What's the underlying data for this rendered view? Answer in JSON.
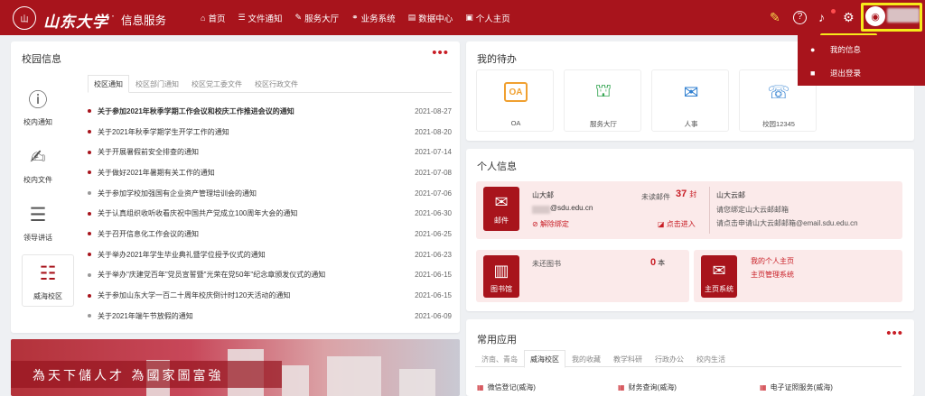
{
  "header": {
    "logo_glyph": "山",
    "brand": "山东大学",
    "separator": "·",
    "subtitle": "信息服务",
    "nav": [
      {
        "icon": "home-icon",
        "glyph": "⌂",
        "label": "首页"
      },
      {
        "icon": "list-icon",
        "glyph": "☰",
        "label": "文件通知"
      },
      {
        "icon": "edit-icon",
        "glyph": "✎",
        "label": "服务大厅"
      },
      {
        "icon": "link-icon",
        "glyph": "⚭",
        "label": "业务系统"
      },
      {
        "icon": "data-icon",
        "glyph": "▤",
        "label": "数据中心"
      },
      {
        "icon": "user-icon",
        "glyph": "▣",
        "label": "个人主页"
      }
    ],
    "icons": {
      "note": "✎",
      "help": "?",
      "bell": "♪",
      "gear": "⚙",
      "avatar": "◉"
    }
  },
  "user_menu": {
    "items": [
      {
        "icon": "person-icon",
        "glyph": "●",
        "label": "我的信息"
      },
      {
        "icon": "lock-icon",
        "glyph": "■",
        "label": "退出登录"
      }
    ]
  },
  "campus": {
    "title": "校园信息",
    "more": "•••",
    "categories": [
      {
        "label": "校内通知",
        "glyph": "ⓘ"
      },
      {
        "label": "校内文件",
        "glyph": "✍"
      },
      {
        "label": "领导讲话",
        "glyph": "☰"
      },
      {
        "label": "威海校区",
        "glyph": "☷"
      }
    ],
    "tabs": [
      "校区通知",
      "校区部门通知",
      "校区党工委文件",
      "校区行政文件"
    ],
    "news": [
      {
        "title": "关于参加2021年秋季学期工作会议和校庆工作推进会议的通知",
        "date": "2021-08-27"
      },
      {
        "title": "关于2021年秋季学期学生开学工作的通知",
        "date": "2021-08-20"
      },
      {
        "title": "关于开展暑假前安全排查的通知",
        "date": "2021-07-14"
      },
      {
        "title": "关于做好2021年暑期有关工作的通知",
        "date": "2021-07-08"
      },
      {
        "title": "关于参加学校加强国有企业资产管理培训会的通知",
        "date": "2021-07-06"
      },
      {
        "title": "关于认真组织收听收看庆祝中国共产党成立100周年大会的通知",
        "date": "2021-06-30"
      },
      {
        "title": "关于召开信息化工作会议的通知",
        "date": "2021-06-25"
      },
      {
        "title": "关于举办2021年学生毕业典礼暨学位授予仪式的通知",
        "date": "2021-06-23"
      },
      {
        "title": "关于举办\"庆建党百年\"党员宣誓暨\"光荣在党50年\"纪念章颁发仪式的通知",
        "date": "2021-06-15"
      },
      {
        "title": "关于参加山东大学一百二十周年校庆倒计时120天活动的通知",
        "date": "2021-06-15"
      },
      {
        "title": "关于2021年端午节放假的通知",
        "date": "2021-06-09"
      }
    ]
  },
  "banner": {
    "slogan": "為天下儲人才 為國家圖富強"
  },
  "todo": {
    "title": "我的待办",
    "items": [
      {
        "label": "OA",
        "icon": "oa-icon",
        "glyph": "OA"
      },
      {
        "label": "服务大厅",
        "icon": "hall-icon",
        "glyph": "⛫"
      },
      {
        "label": "人事",
        "icon": "hr-icon",
        "glyph": "✉"
      },
      {
        "label": "校园12345",
        "icon": "hotline-icon",
        "glyph": "☏"
      }
    ]
  },
  "personal": {
    "title": "个人信息",
    "mail": {
      "label": "邮件",
      "glyph": "✉",
      "account_label": "山大邮",
      "address": "@sdu.edu.cn",
      "unread_label": "未读邮件",
      "unread_count": "37",
      "unread_unit": "封",
      "unbind": "解除绑定",
      "enter": "点击进入",
      "yun_title": "山大云邮",
      "yun_line1": "请您绑定山大云邮邮箱",
      "yun_line2": "请点击申请山大云邮邮箱@email.sdu.edu.cn"
    },
    "library": {
      "label": "图书馆",
      "glyph": "▥",
      "text": "未还图书",
      "count": "0",
      "unit": "本"
    },
    "homepage": {
      "label": "主页系统",
      "glyph": "✉",
      "line1": "我的个人主页",
      "line2": "主页管理系统"
    }
  },
  "apps": {
    "title": "常用应用",
    "more": "•••",
    "tabs": [
      "济南、青岛",
      "威海校区",
      "我的收藏",
      "教学科研",
      "行政办公",
      "校内生活"
    ],
    "items": [
      "微信登记(威海)",
      "财务查询(威海)",
      "电子证照服务(威海)"
    ]
  }
}
